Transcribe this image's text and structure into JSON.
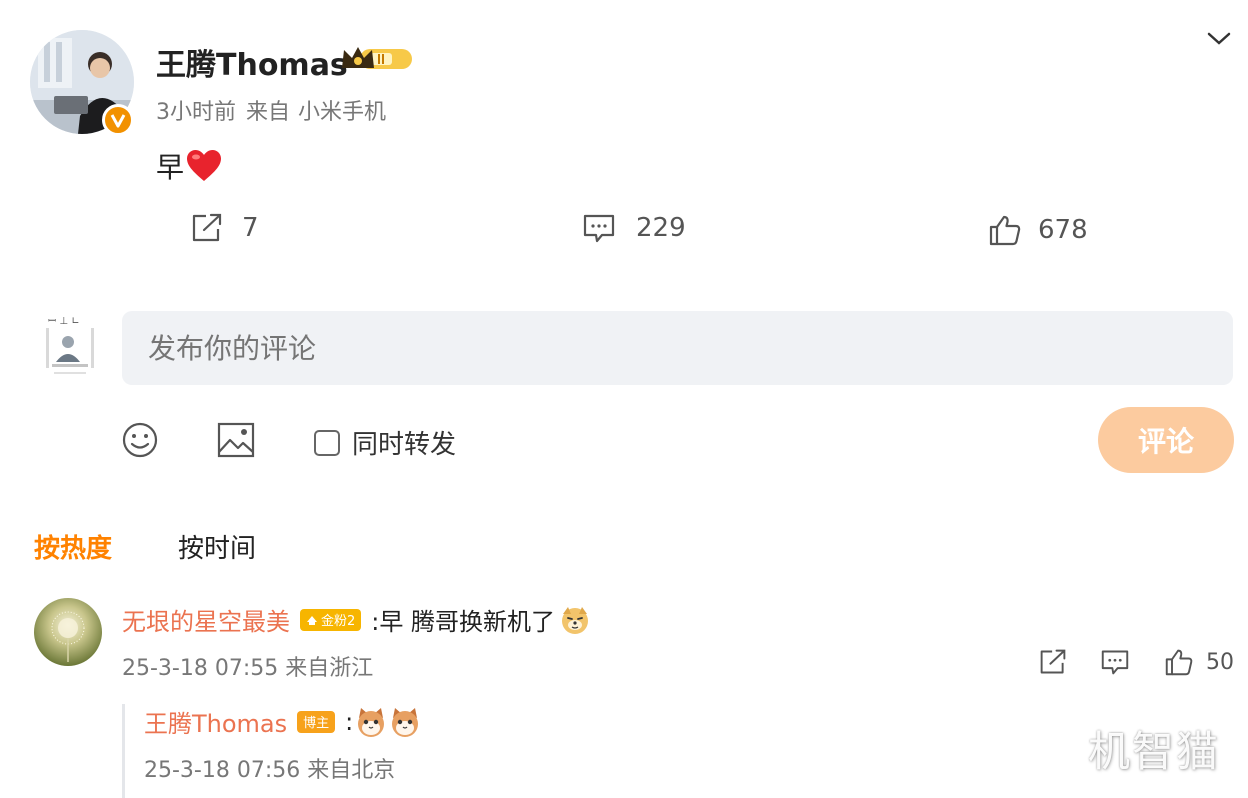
{
  "post": {
    "author": "王腾Thomas",
    "time": "3小时前",
    "source_prefix": "来自",
    "source": "小米手机",
    "text": "早",
    "actions": {
      "repost_count": "7",
      "comment_count": "229",
      "like_count": "678"
    },
    "icons": [
      "avatar",
      "verified-badge-icon",
      "vip-crown-badge-icon",
      "chevron-down-icon",
      "heart-emoji-icon",
      "repost-icon",
      "comment-icon",
      "like-icon"
    ]
  },
  "compose": {
    "placeholder": "发布你的评论",
    "repost_label": "同时转发",
    "submit_label": "评论",
    "icons": [
      "emoji-icon",
      "image-icon"
    ]
  },
  "sort": {
    "hot_label": "按热度",
    "time_label": "按时间"
  },
  "comments": [
    {
      "name": "无垠的星空最美",
      "badge": "金粉2",
      "text": ":早 腾哥换新机了",
      "meta": "25-3-18 07:55 来自浙江",
      "like_count": "50",
      "reply": {
        "name": "王腾Thomas",
        "badge": "博主",
        "text": ":",
        "meta": "25-3-18 07:56 来自北京"
      }
    }
  ],
  "watermark": "机智猫",
  "colors": {
    "accent_orange": "#ff8200",
    "username_link": "#eb7350",
    "submit_disabled": "#fccb9f",
    "input_bg": "#f0f2f5",
    "verified": "#f29100"
  }
}
